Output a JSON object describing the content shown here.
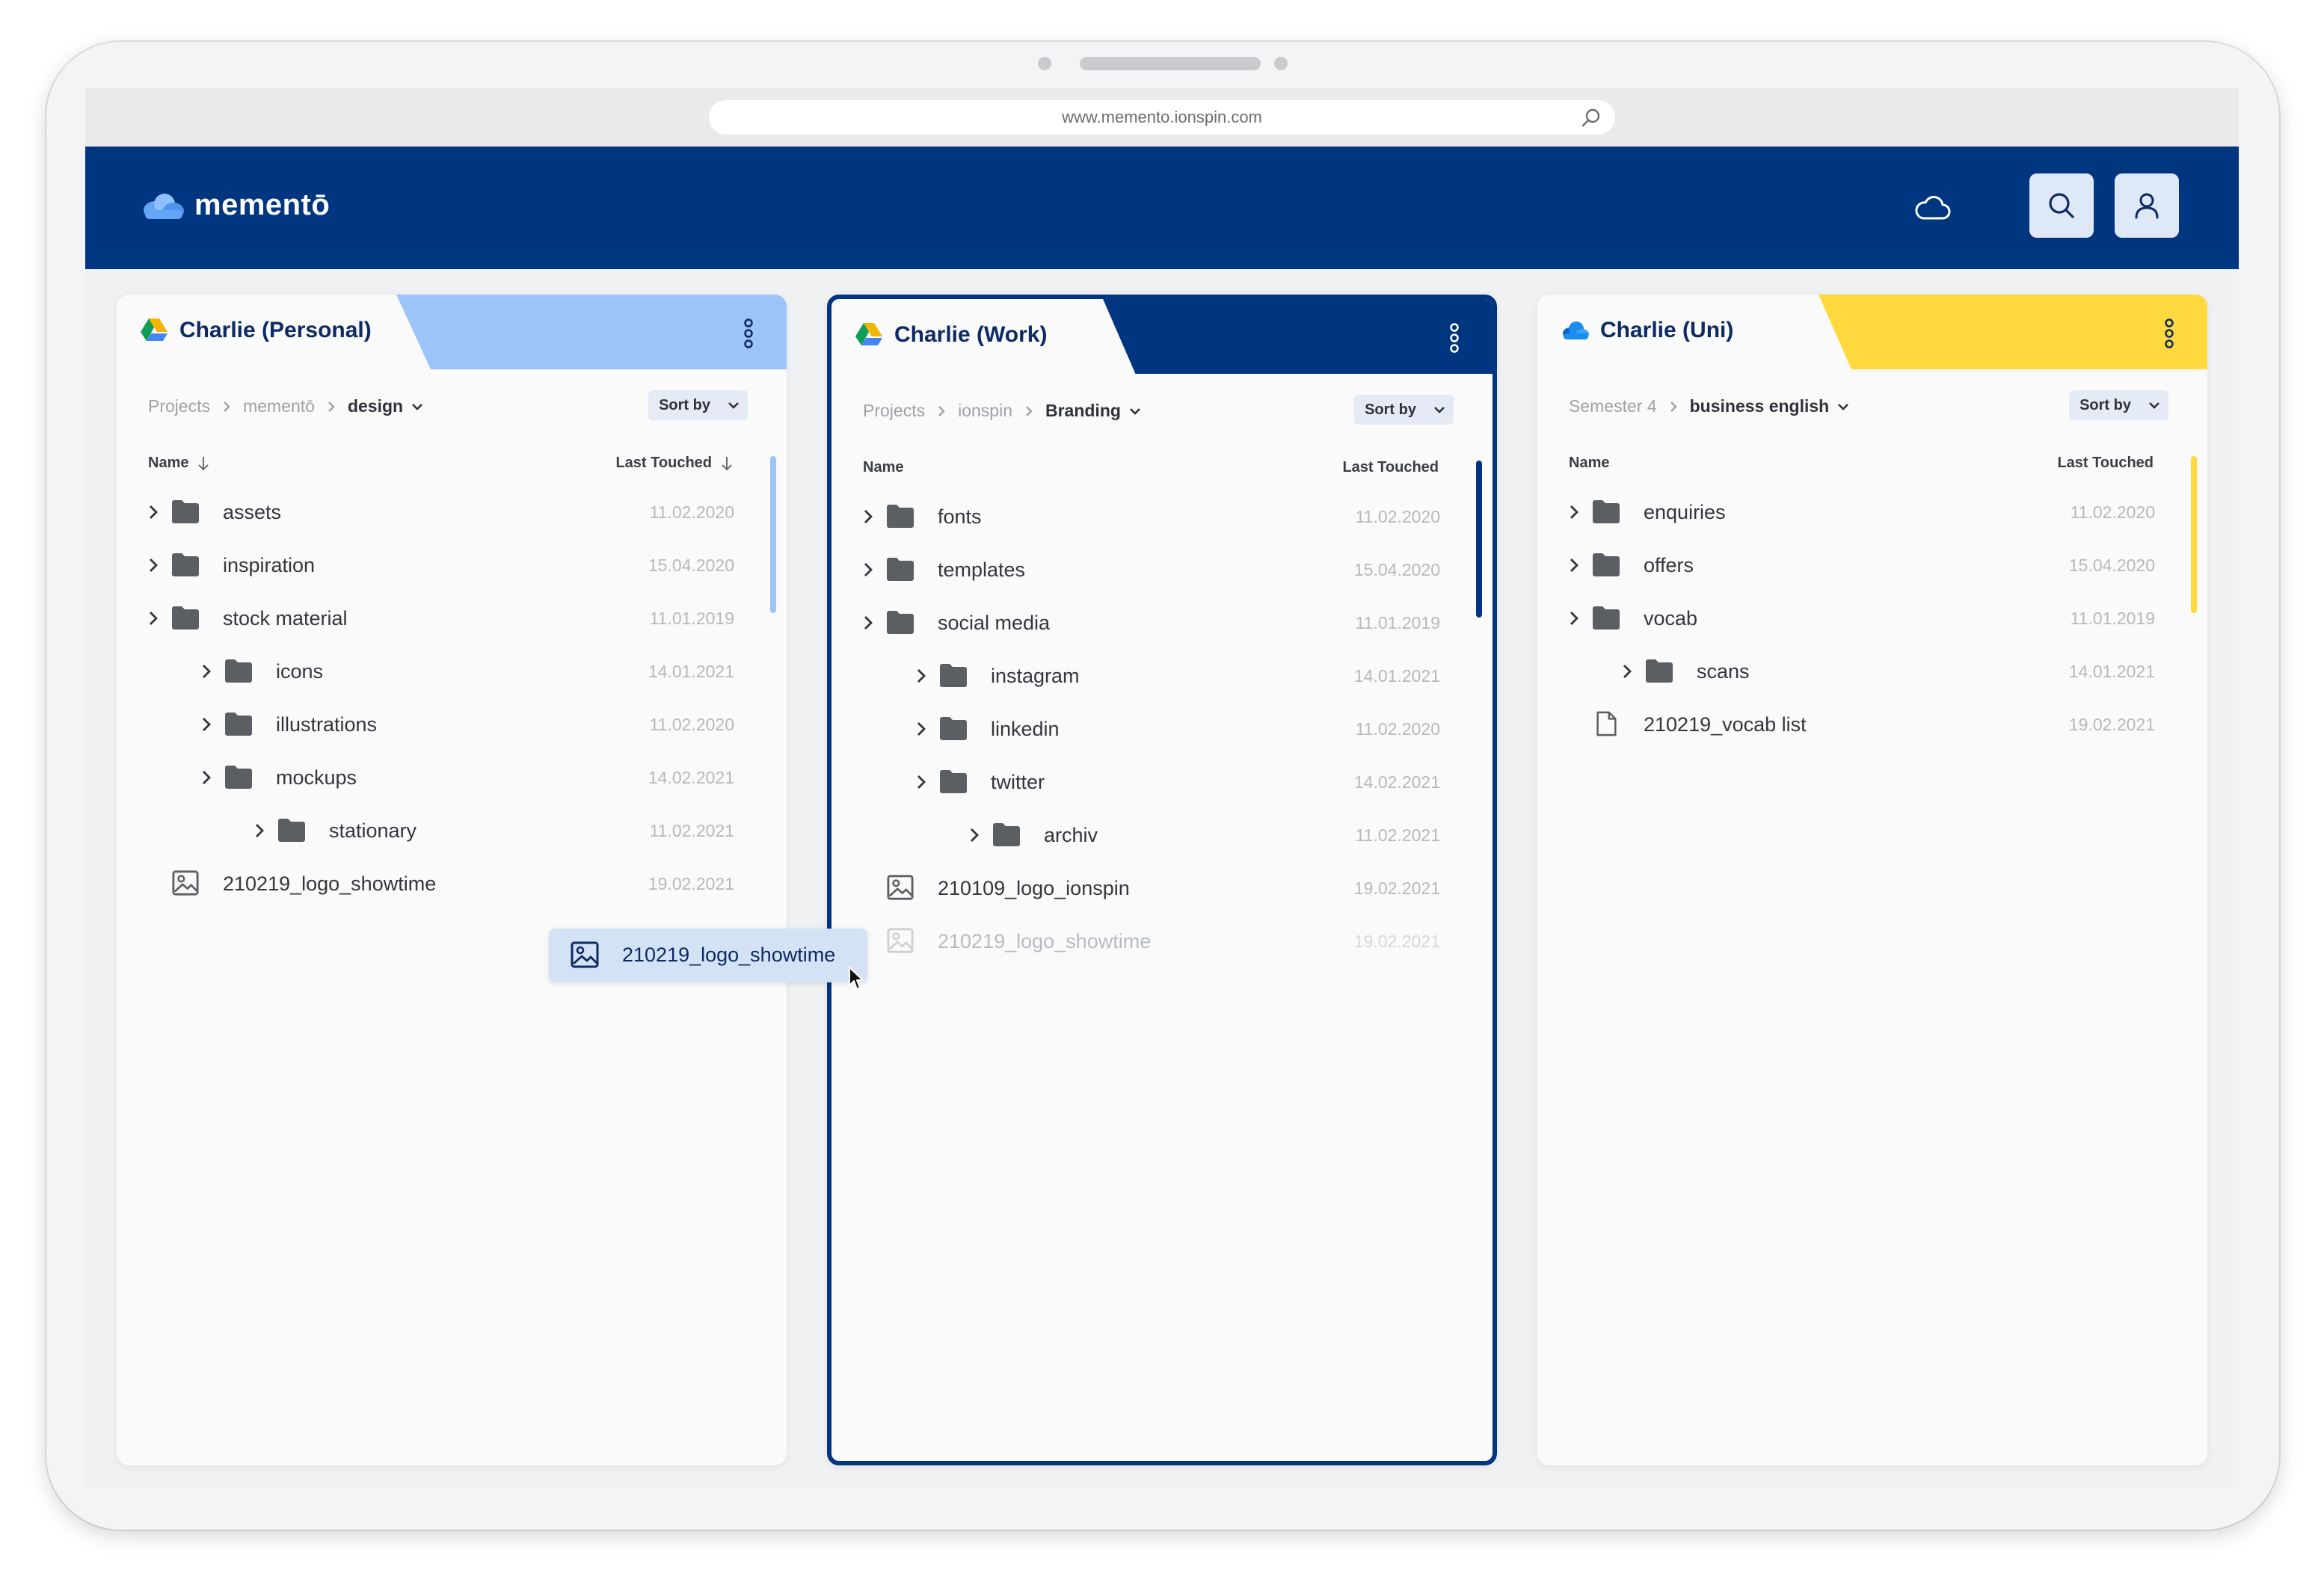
{
  "browser": {
    "url": "www.memento.ionspin.com"
  },
  "app": {
    "name": "mementō"
  },
  "colors": {
    "brand": "#003580",
    "personal_accent": "#9cc4fa",
    "work_accent": "#003580",
    "uni_accent": "#ffd93d"
  },
  "panels": [
    {
      "title": "Charlie (Personal)",
      "service": "google-drive",
      "breadcrumb": [
        "Projects",
        "mementō"
      ],
      "current_folder": "design",
      "sort_label": "Sort by",
      "columns": {
        "name": "Name",
        "last_touched": "Last Touched"
      },
      "rows": [
        {
          "name": "assets",
          "date": "11.02.2020",
          "type": "folder",
          "depth": 0
        },
        {
          "name": "inspiration",
          "date": "15.04.2020",
          "type": "folder",
          "depth": 0
        },
        {
          "name": "stock material",
          "date": "11.01.2019",
          "type": "folder",
          "depth": 0
        },
        {
          "name": "icons",
          "date": "14.01.2021",
          "type": "folder",
          "depth": 1
        },
        {
          "name": "illustrations",
          "date": "11.02.2020",
          "type": "folder",
          "depth": 1
        },
        {
          "name": "mockups",
          "date": "14.02.2021",
          "type": "folder",
          "depth": 1
        },
        {
          "name": "stationary",
          "date": "11.02.2021",
          "type": "folder",
          "depth": 2
        },
        {
          "name": "210219_logo_showtime",
          "date": "19.02.2021",
          "type": "image",
          "depth": 0
        }
      ]
    },
    {
      "title": "Charlie (Work)",
      "service": "google-drive",
      "breadcrumb": [
        "Projects",
        "ionspin"
      ],
      "current_folder": "Branding",
      "sort_label": "Sort by",
      "columns": {
        "name": "Name",
        "last_touched": "Last Touched"
      },
      "rows": [
        {
          "name": "fonts",
          "date": "11.02.2020",
          "type": "folder",
          "depth": 0
        },
        {
          "name": "templates",
          "date": "15.04.2020",
          "type": "folder",
          "depth": 0
        },
        {
          "name": "social media",
          "date": "11.01.2019",
          "type": "folder",
          "depth": 0
        },
        {
          "name": "instagram",
          "date": "14.01.2021",
          "type": "folder",
          "depth": 1
        },
        {
          "name": "linkedin",
          "date": "11.02.2020",
          "type": "folder",
          "depth": 1
        },
        {
          "name": "twitter",
          "date": "14.02.2021",
          "type": "folder",
          "depth": 1
        },
        {
          "name": "archiv",
          "date": "11.02.2021",
          "type": "folder",
          "depth": 2
        },
        {
          "name": "210109_logo_ionspin",
          "date": "19.02.2021",
          "type": "image",
          "depth": 0
        },
        {
          "name": "210219_logo_showtime",
          "date": "19.02.2021",
          "type": "image",
          "depth": 0,
          "state": "drop-preview"
        }
      ]
    },
    {
      "title": "Charlie (Uni)",
      "service": "onedrive",
      "breadcrumb": [
        "Semester 4"
      ],
      "current_folder": "business english",
      "sort_label": "Sort by",
      "columns": {
        "name": "Name",
        "last_touched": "Last Touched"
      },
      "rows": [
        {
          "name": "enquiries",
          "date": "11.02.2020",
          "type": "folder",
          "depth": 0
        },
        {
          "name": "offers",
          "date": "15.04.2020",
          "type": "folder",
          "depth": 0
        },
        {
          "name": "vocab",
          "date": "11.01.2019",
          "type": "folder",
          "depth": 0
        },
        {
          "name": "scans",
          "date": "14.01.2021",
          "type": "folder",
          "depth": 1
        },
        {
          "name": "210219_vocab list",
          "date": "19.02.2021",
          "type": "file",
          "depth": 0
        }
      ]
    }
  ],
  "drag_item": {
    "name": "210219_logo_showtime",
    "type": "image"
  }
}
